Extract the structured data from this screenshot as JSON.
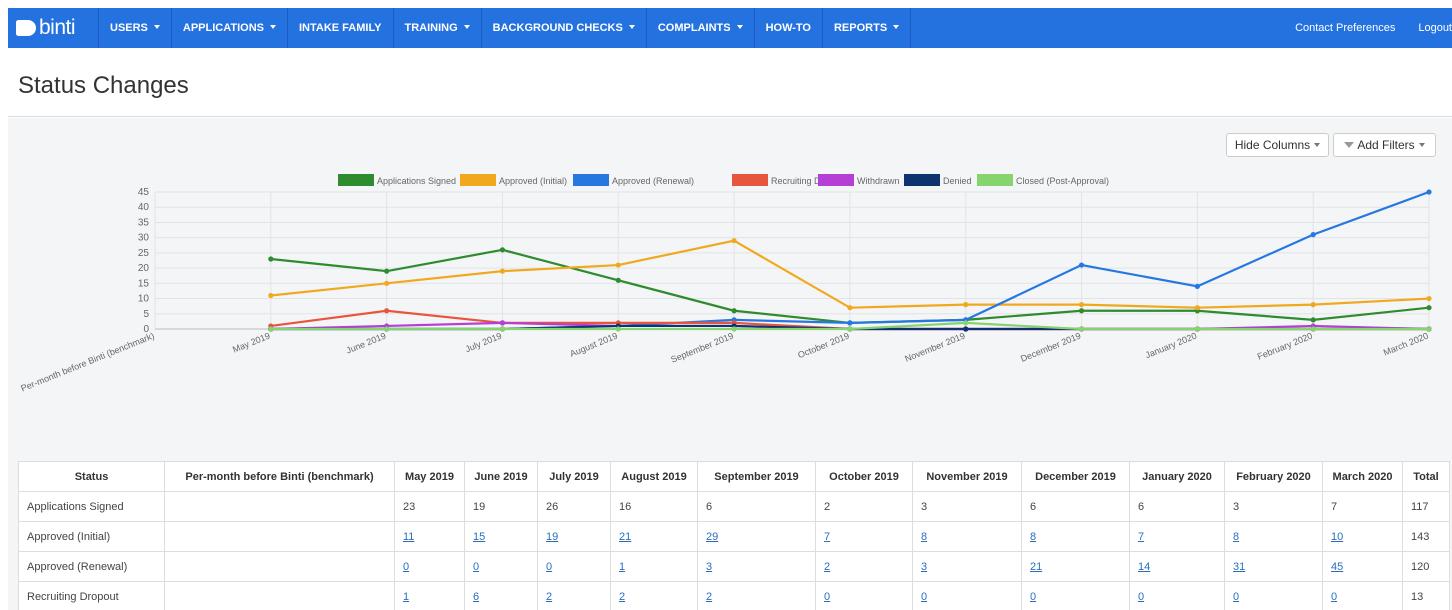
{
  "nav": {
    "brand": "binti",
    "items": [
      {
        "label": "USERS",
        "dropdown": true
      },
      {
        "label": "APPLICATIONS",
        "dropdown": true
      },
      {
        "label": "INTAKE FAMILY",
        "dropdown": false
      },
      {
        "label": "TRAINING",
        "dropdown": true
      },
      {
        "label": "BACKGROUND CHECKS",
        "dropdown": true
      },
      {
        "label": "COMPLAINTS",
        "dropdown": true
      },
      {
        "label": "HOW-TO",
        "dropdown": false
      },
      {
        "label": "REPORTS",
        "dropdown": true
      }
    ],
    "right": {
      "contact_preferences": "Contact Preferences",
      "logout": "Logout"
    }
  },
  "page": {
    "title": "Status Changes"
  },
  "toolbar": {
    "hide_columns": "Hide Columns",
    "add_filters": "Add Filters"
  },
  "chart_data": {
    "type": "line",
    "categories": [
      "Per-month before Binti (benchmark)",
      "May 2019",
      "June 2019",
      "July 2019",
      "August 2019",
      "September 2019",
      "October 2019",
      "November 2019",
      "December 2019",
      "January 2020",
      "February 2020",
      "March 2020"
    ],
    "ylim": [
      0,
      45
    ],
    "yticks": [
      0,
      5,
      10,
      15,
      20,
      25,
      30,
      35,
      40,
      45
    ],
    "legend_position": "top-center",
    "grid": true,
    "series": [
      {
        "name": "Applications Signed",
        "color": "#2e8b2e",
        "values": [
          null,
          23,
          19,
          26,
          16,
          6,
          2,
          3,
          6,
          6,
          3,
          7
        ]
      },
      {
        "name": "Approved (Initial)",
        "color": "#f0a91e",
        "values": [
          null,
          11,
          15,
          19,
          21,
          29,
          7,
          8,
          8,
          7,
          8,
          10
        ]
      },
      {
        "name": "Approved (Renewal)",
        "color": "#2678e0",
        "values": [
          null,
          0,
          0,
          0,
          1,
          3,
          2,
          3,
          21,
          14,
          31,
          45
        ]
      },
      {
        "name": "Recruiting Dropout",
        "color": "#e8553e",
        "values": [
          null,
          1,
          6,
          2,
          2,
          2,
          0,
          0,
          0,
          0,
          0,
          0
        ]
      },
      {
        "name": "Withdrawn",
        "color": "#b53fd6",
        "values": [
          null,
          0,
          1,
          2,
          1,
          1,
          0,
          0,
          0,
          0,
          1,
          0
        ]
      },
      {
        "name": "Denied",
        "color": "#0e3470",
        "values": [
          null,
          0,
          0,
          0,
          1,
          1,
          0,
          0,
          0,
          0,
          0,
          0
        ]
      },
      {
        "name": "Closed (Post-Approval)",
        "color": "#86d46e",
        "values": [
          null,
          0,
          0,
          0,
          0,
          0,
          0,
          2,
          0,
          0,
          0,
          0
        ]
      }
    ]
  },
  "table": {
    "headers": [
      "Status",
      "Per-month before Binti (benchmark)",
      "May 2019",
      "June 2019",
      "July 2019",
      "August 2019",
      "September 2019",
      "October 2019",
      "November 2019",
      "December 2019",
      "January 2020",
      "February 2020",
      "March 2020",
      "Total"
    ],
    "rows": [
      {
        "status": "Applications Signed",
        "benchmark": "",
        "links": false,
        "values": [
          "23",
          "19",
          "26",
          "16",
          "6",
          "2",
          "3",
          "6",
          "6",
          "3",
          "7"
        ],
        "total": "117"
      },
      {
        "status": "Approved (Initial)",
        "benchmark": "",
        "links": true,
        "values": [
          "11",
          "15",
          "19",
          "21",
          "29",
          "7",
          "8",
          "8",
          "7",
          "8",
          "10"
        ],
        "total": "143"
      },
      {
        "status": "Approved (Renewal)",
        "benchmark": "",
        "links": true,
        "values": [
          "0",
          "0",
          "0",
          "1",
          "3",
          "2",
          "3",
          "21",
          "14",
          "31",
          "45"
        ],
        "total": "120"
      },
      {
        "status": "Recruiting Dropout",
        "benchmark": "",
        "links": true,
        "values": [
          "1",
          "6",
          "2",
          "2",
          "2",
          "0",
          "0",
          "0",
          "0",
          "0",
          "0"
        ],
        "total": "13"
      }
    ]
  }
}
